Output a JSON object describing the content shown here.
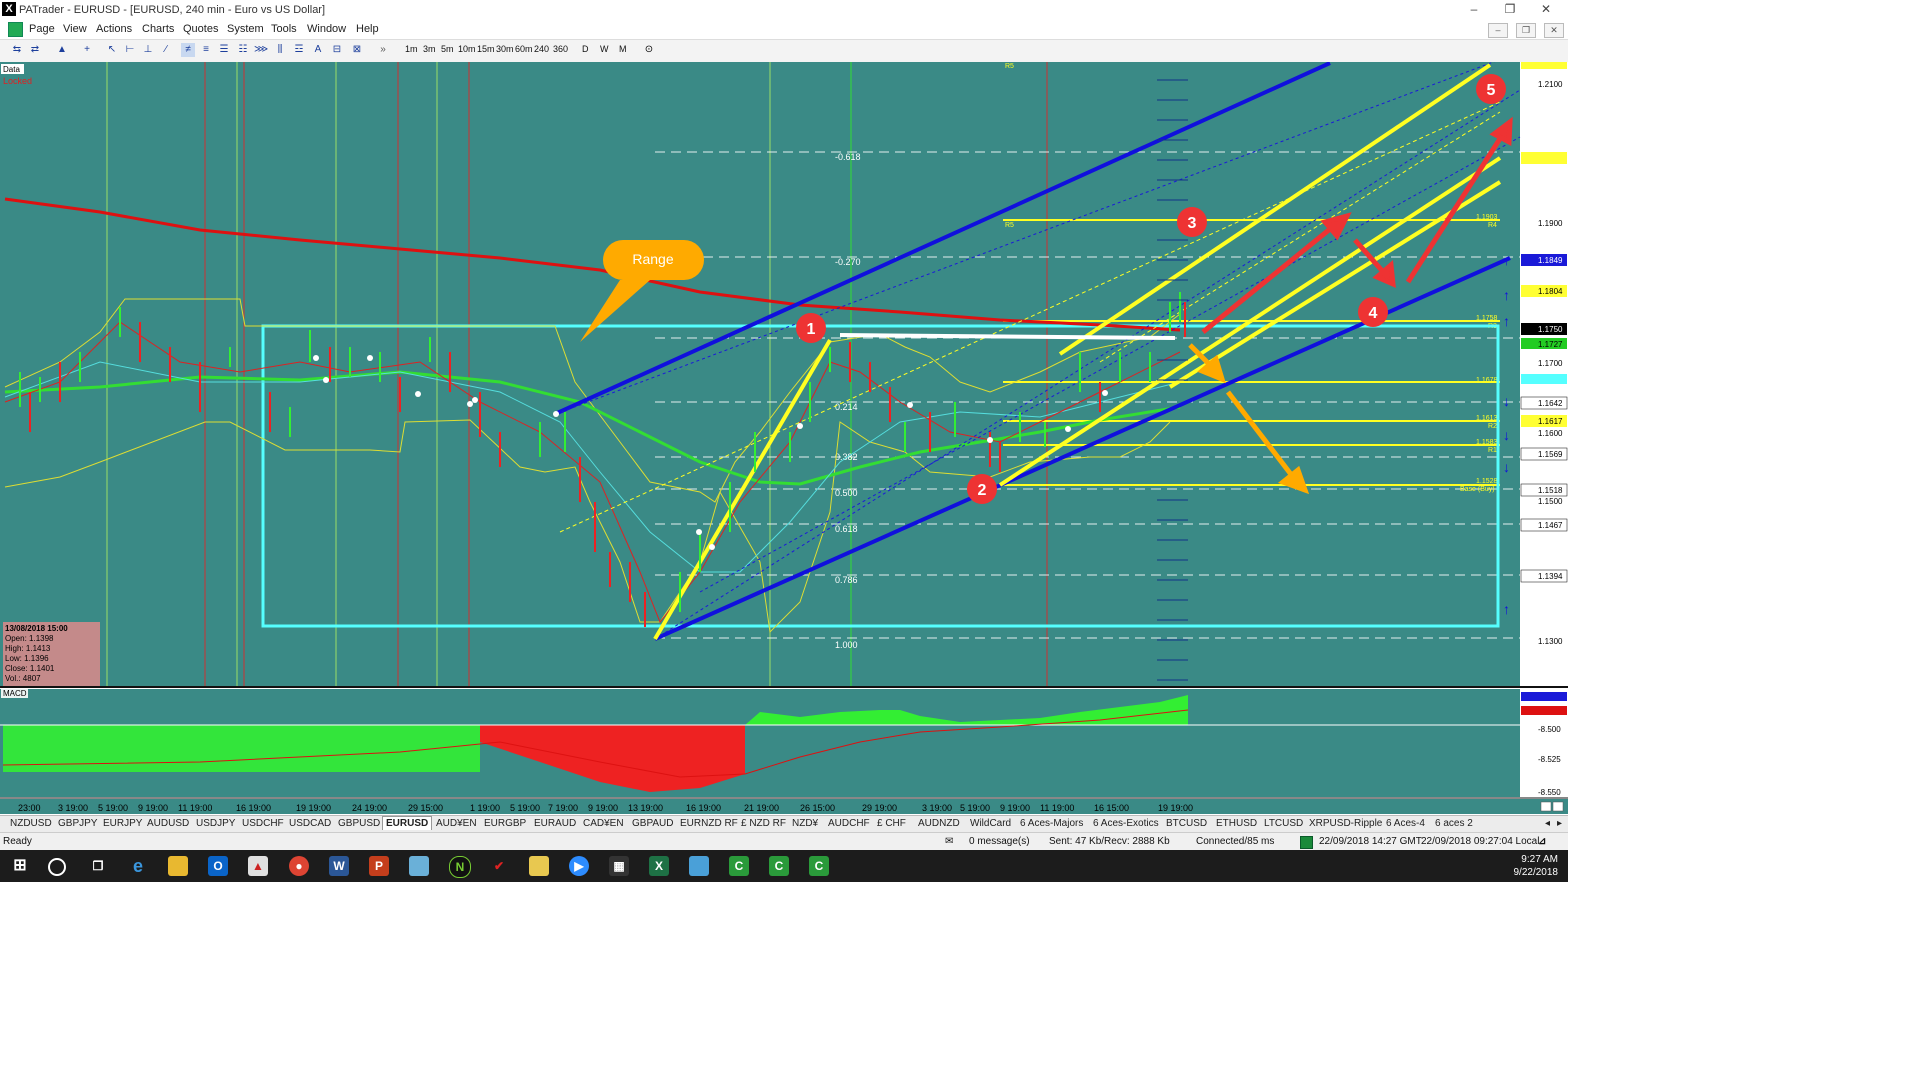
{
  "window": {
    "app_icon": "X",
    "title": "PATrader - EURUSD - [EURUSD, 240 min - Euro vs US Dollar]",
    "minimize": "–",
    "restore": "❐",
    "close": "✕"
  },
  "menu": [
    "Page",
    "View",
    "Actions",
    "Charts",
    "Quotes",
    "System",
    "Tools",
    "Window",
    "Help"
  ],
  "mdi_controls": [
    "–",
    "❐",
    "✕"
  ],
  "timeframes": [
    "1m",
    "3m",
    "5m",
    "10m",
    "15m",
    "30m",
    "60m",
    "240",
    "360",
    "D",
    "W",
    "M"
  ],
  "chart": {
    "data_label": "Data",
    "locked_label": "Locked",
    "range_callout": "Range",
    "info": {
      "date": "13/08/2018 15:00",
      "open": "Open: 1.1398",
      "high": "High: 1.1413",
      "low": "Low: 1.1396",
      "close": "Close: 1.1401",
      "vol": "Vol.: 4807"
    },
    "fib_labels": [
      "-0.618",
      "-0.270",
      "0.214",
      "0.382",
      "0.500",
      "0.618",
      "0.786",
      "1.000"
    ],
    "pivot_labels": [
      "R5",
      "R5",
      "R4",
      "R3",
      "R2",
      "R1",
      "Base (Buy)"
    ],
    "level_labels": [
      "1.1903",
      "1.1758",
      "1.1678",
      "1.1613",
      "1.1583",
      "1.1528"
    ],
    "price_axis": [
      "1.2100",
      "1.1900",
      "1.1700",
      "1.1600",
      "1.1500",
      "1.1300"
    ],
    "price_tags": [
      {
        "text": "1.1849",
        "bg": "#1a1ad8",
        "fg": "#ffffff"
      },
      {
        "text": "1.1804",
        "bg": "#ffff33",
        "fg": "#000000"
      },
      {
        "text": "1.1750",
        "bg": "#000000",
        "fg": "#ffffff"
      },
      {
        "text": "1.1727",
        "bg": "#22cc22",
        "fg": "#000000"
      },
      {
        "text": "1.1642",
        "bg": "#ffffff",
        "fg": "#000000"
      },
      {
        "text": "1.1617",
        "bg": "#ffff33",
        "fg": "#000000"
      },
      {
        "text": "1.1569",
        "bg": "#ffffff",
        "fg": "#000000"
      },
      {
        "text": "1.1518",
        "bg": "#ffffff",
        "fg": "#000000"
      },
      {
        "text": "1.1467",
        "bg": "#ffffff",
        "fg": "#000000"
      },
      {
        "text": "1.1394",
        "bg": "#ffffff",
        "fg": "#000000"
      }
    ],
    "markers": [
      "1",
      "2",
      "3",
      "4",
      "5"
    ],
    "macd_label": "MACD",
    "macd_axis": [
      "-8.500",
      "-8.525",
      "-8.550"
    ],
    "time_axis": [
      "23:00",
      "3 19:00",
      "5 19:00",
      "9 19:00",
      "11 19:00",
      "16 19:00",
      "19 19:00",
      "24 19:00",
      "29 15:00",
      "1 19:00",
      "5 19:00",
      "7 19:00",
      "9 19:00",
      "13 19:00",
      "16 19:00",
      "21 19:00",
      "26 15:00",
      "29 19:00",
      "3 19:00",
      "5 19:00",
      "9 19:00",
      "11 19:00",
      "16 15:00",
      "19 19:00"
    ]
  },
  "tabs": [
    "NZDUSD",
    "GBPJPY",
    "EURJPY",
    "AUDUSD",
    "USDJPY",
    "USDCHF",
    "USDCAD",
    "GBPUSD",
    "EURUSD",
    "AUD¥EN",
    "EURGBP",
    "EURAUD",
    "CAD¥EN",
    "GBPAUD",
    "EURNZD RF",
    "£ NZD RF",
    "NZD¥",
    "AUDCHF",
    "£ CHF",
    "AUDNZD",
    "WildCard",
    "6 Aces-Majors",
    "6 Aces-Exotics",
    "BTCUSD",
    "ETHUSD",
    "LTCUSD",
    "XRPUSD-Ripple",
    "6 Aces-4",
    "6 aces 2"
  ],
  "active_tab": "EURUSD",
  "status": {
    "ready": "Ready",
    "messages": "0 message(s)",
    "traffic": "Sent: 47 Kb/Recv: 2888 Kb",
    "connected": "Connected/85 ms",
    "gmt": "22/09/2018 14:27 GMT",
    "local": "22/09/2018 09:27:04 Local"
  },
  "taskbar": {
    "time": "9:27 AM",
    "date": "9/22/2018",
    "icons": [
      "start-icon",
      "search-icon",
      "task-view-icon",
      "edge-icon",
      "explorer-icon",
      "outlook-icon",
      "chart-app-icon",
      "chrome-icon",
      "word-icon",
      "powerpoint-icon",
      "notes-icon",
      "ninja-icon",
      "trading-icon",
      "folder-icon",
      "zoom-icon",
      "calculator-icon",
      "excel-icon",
      "remote-icon",
      "camtasia-icon",
      "camtasia-recorder-icon",
      "camtasia-studio-icon"
    ]
  },
  "colors": {
    "chart_bg": "#3a8a86",
    "macd_bg": "#3a8a86",
    "channel_blue": "#1010dd",
    "channel_yellow": "#ffff22",
    "range_box": "#55ffff",
    "ma_red": "#dd1111",
    "ma_green": "#33dd33",
    "arrow_red": "#ee3333",
    "arrow_orange": "#ffaa00"
  }
}
